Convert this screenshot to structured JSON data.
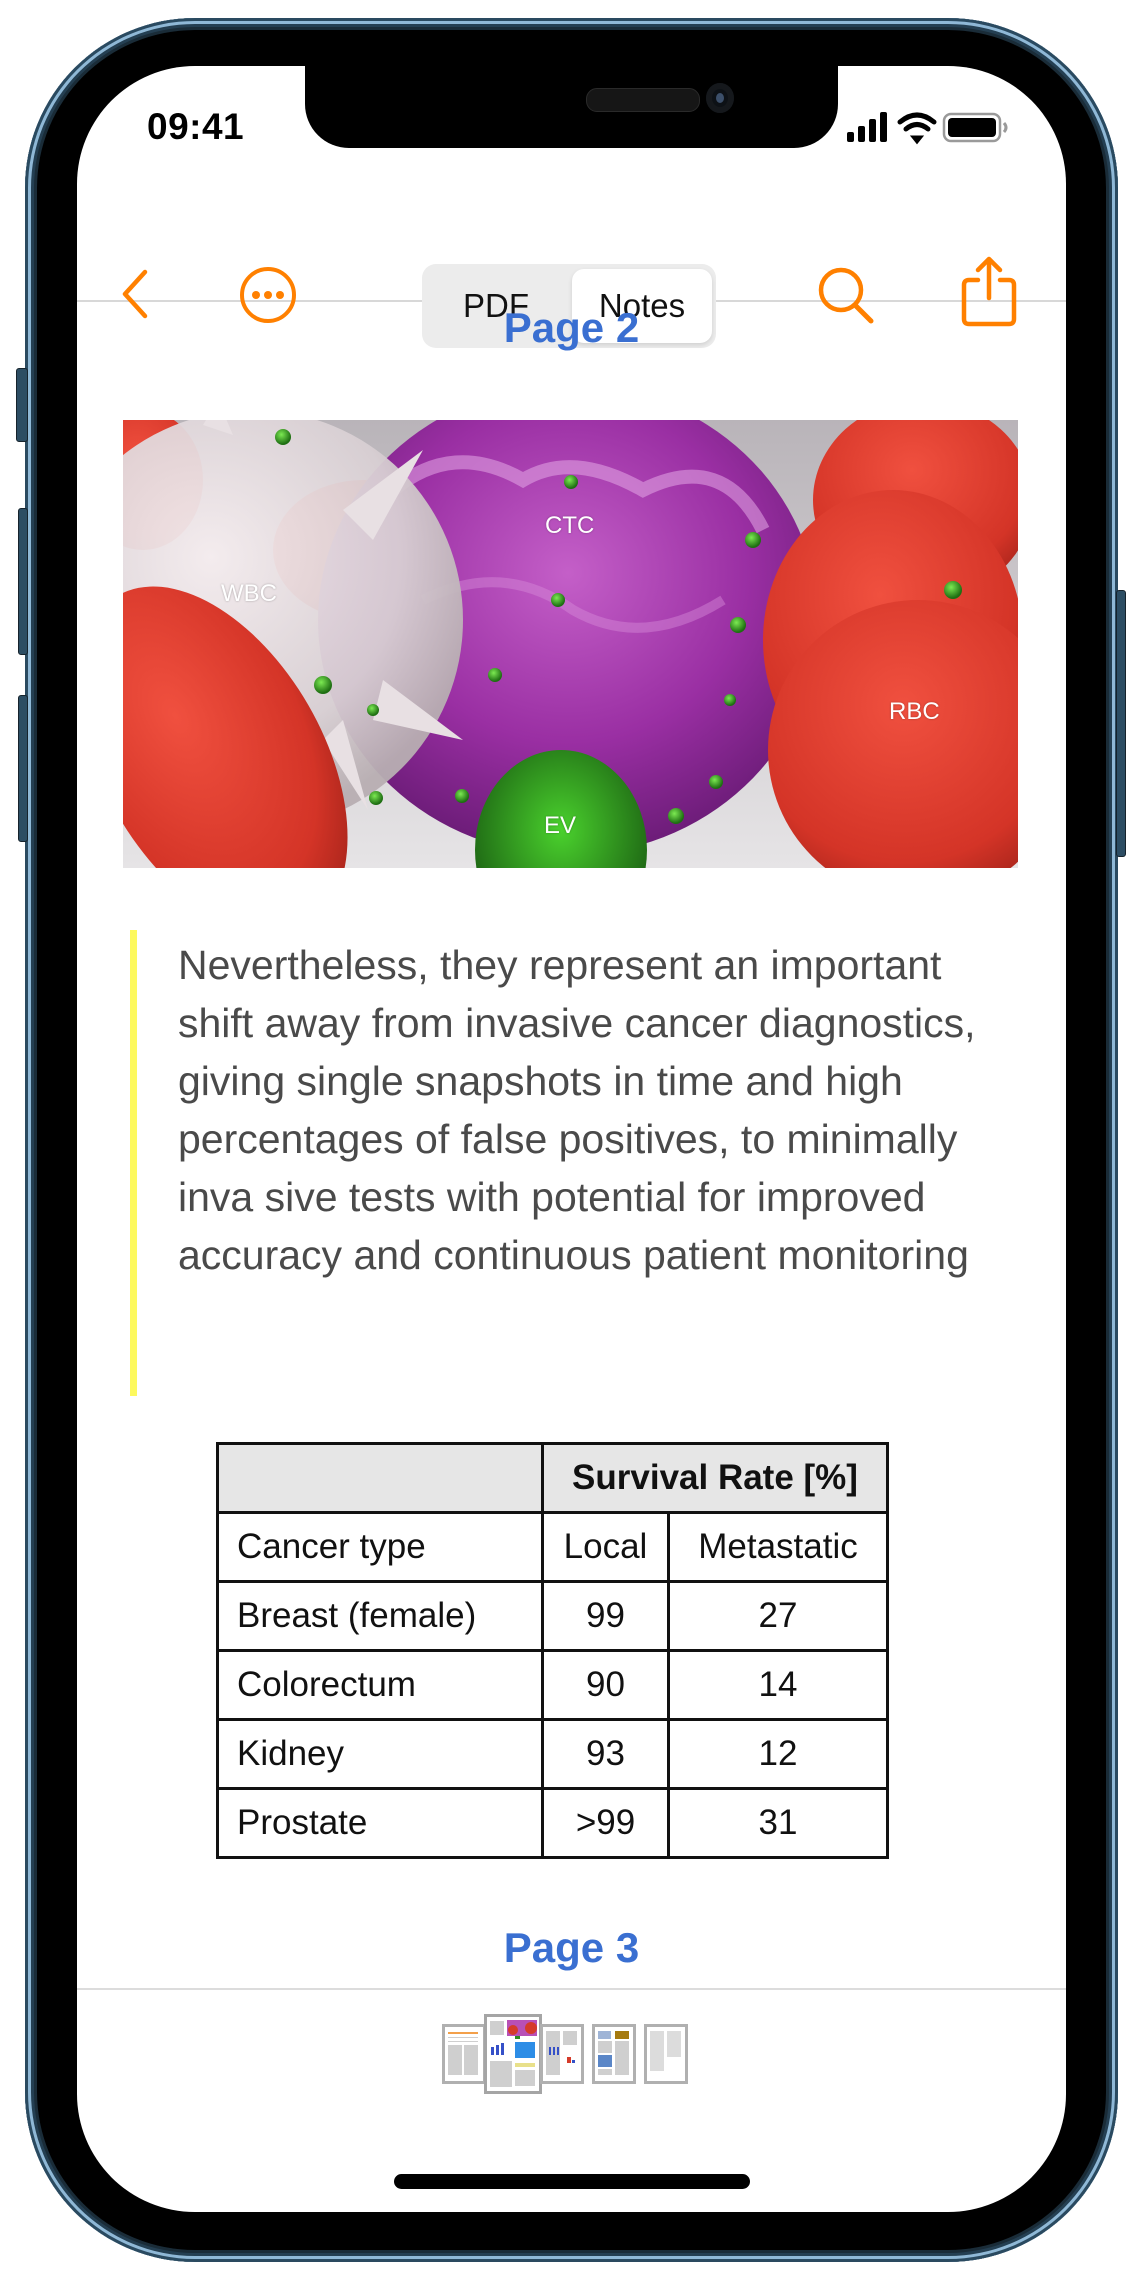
{
  "status_bar": {
    "time": "09:41",
    "icons": [
      "cellular-signal-icon",
      "wifi-icon",
      "battery-icon"
    ]
  },
  "navbar": {
    "back_icon": "chevron-left-icon",
    "more_icon": "ellipsis-circle-icon",
    "segments": [
      {
        "label": "PDF",
        "selected": false
      },
      {
        "label": "Notes",
        "selected": true
      }
    ],
    "search_icon": "magnifying-glass-icon",
    "share_icon": "share-icon",
    "accent_color": "#ff8000"
  },
  "content": {
    "page2_title": "Page 2",
    "figure": {
      "labels": {
        "wbc": "WBC",
        "ctc": "CTC",
        "rbc": "RBC",
        "ev": "EV"
      }
    },
    "quote": {
      "highlight_color": "#fdf95e",
      "text": "Nevertheless, they represent an important shift away from invasive cancer diagnostics, giving single snapshots in time and high percentages of false positives, to minimally inva sive tests with potential for improved accuracy and continuous patient monitoring"
    },
    "table": {
      "group_header": "Survival Rate [%]",
      "columns": [
        "Cancer type",
        "Local",
        "Metastatic"
      ],
      "rows": [
        [
          "Breast (female)",
          "99",
          "27"
        ],
        [
          "Colorectum",
          "90",
          "14"
        ],
        [
          "Kidney",
          "93",
          "12"
        ],
        [
          "Prostate",
          ">99",
          "31"
        ]
      ]
    },
    "page3_title": "Page 3"
  },
  "thumbnails": {
    "count": 5,
    "selected_index": 1
  }
}
